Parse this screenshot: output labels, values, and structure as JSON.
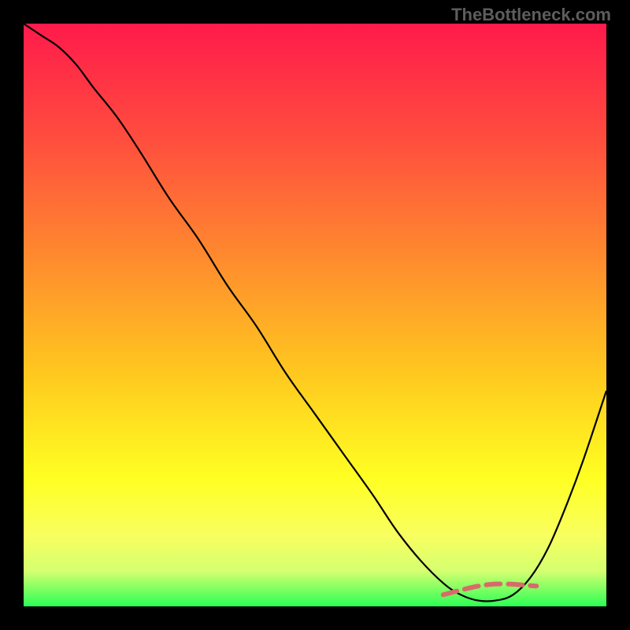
{
  "watermark": "TheBottleneck.com",
  "colors": {
    "frame": "#000000",
    "gradient_stops": [
      {
        "offset": 0.0,
        "color": "#ff1a4b"
      },
      {
        "offset": 0.2,
        "color": "#ff4e3e"
      },
      {
        "offset": 0.4,
        "color": "#ff8a2e"
      },
      {
        "offset": 0.6,
        "color": "#ffc81f"
      },
      {
        "offset": 0.78,
        "color": "#ffff22"
      },
      {
        "offset": 0.88,
        "color": "#f8ff60"
      },
      {
        "offset": 0.94,
        "color": "#d4ff70"
      },
      {
        "offset": 1.0,
        "color": "#2bff55"
      }
    ],
    "curve": "#000000",
    "highlight": "#d96a6a"
  },
  "chart_data": {
    "type": "line",
    "title": "",
    "xlabel": "",
    "ylabel": "",
    "xlim": [
      0,
      100
    ],
    "ylim": [
      0,
      100
    ],
    "grid": false,
    "series": [
      {
        "name": "bottleneck-curve",
        "x": [
          0,
          3,
          6,
          9,
          12,
          16,
          20,
          25,
          30,
          35,
          40,
          45,
          50,
          55,
          60,
          64,
          68,
          72,
          75,
          78,
          81,
          84,
          87,
          90,
          93,
          96,
          100
        ],
        "values": [
          100,
          98,
          96,
          93,
          89,
          84,
          78,
          70,
          63,
          55,
          48,
          40,
          33,
          26,
          19,
          13,
          8,
          4,
          2,
          1,
          1,
          2,
          5,
          10,
          17,
          25,
          37
        ]
      }
    ],
    "annotations": [
      {
        "name": "optimal-range-marker",
        "type": "segment",
        "style": "dashed",
        "color": "#d96a6a",
        "x": [
          72,
          88
        ],
        "values": [
          2.0,
          3.5
        ]
      }
    ]
  }
}
